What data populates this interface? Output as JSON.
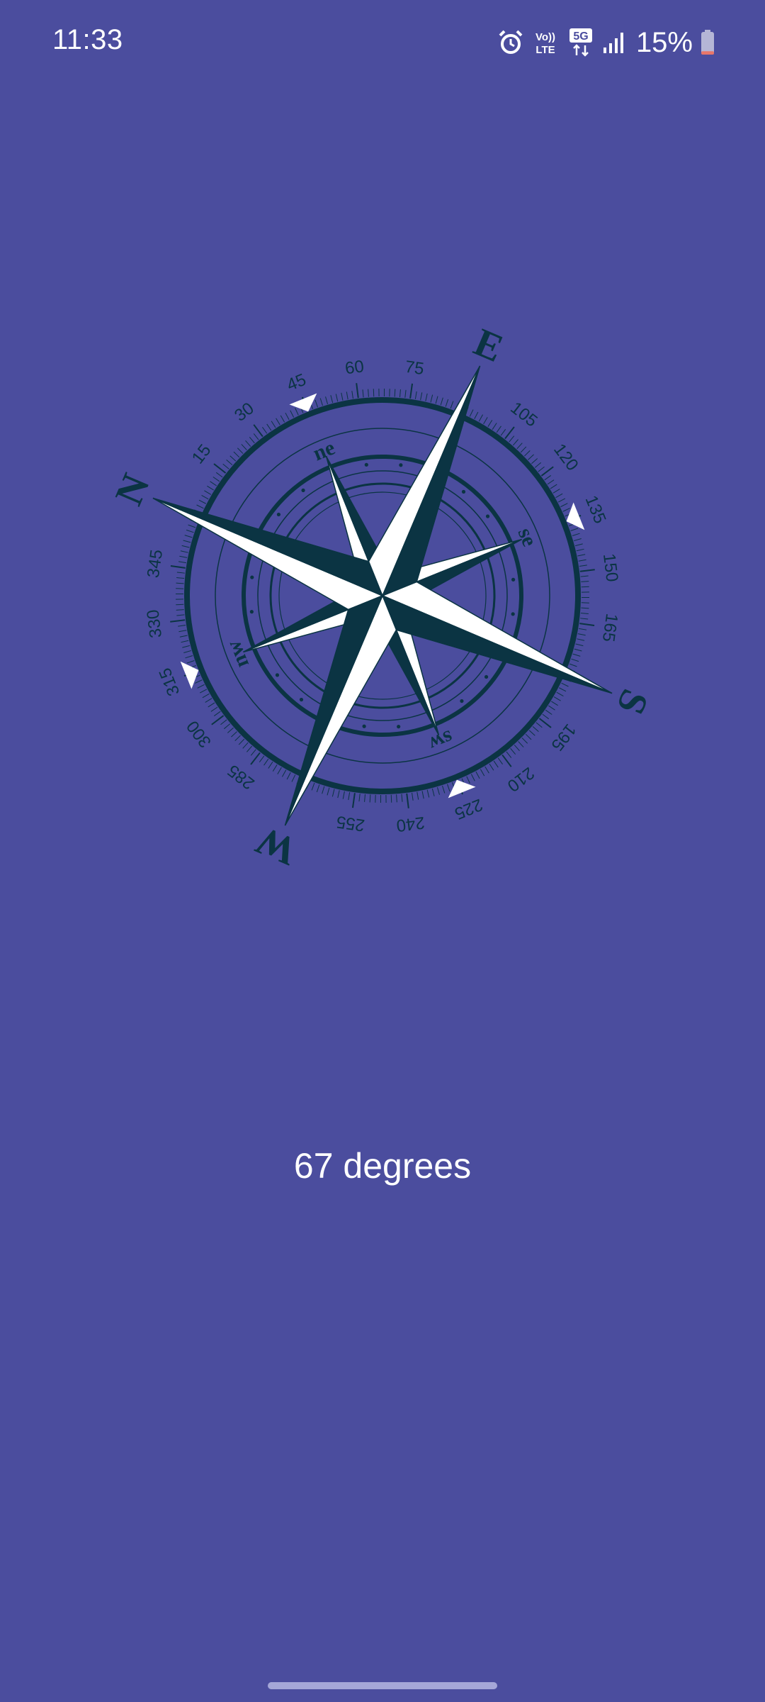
{
  "status_bar": {
    "time": "11:33",
    "alarm_icon": "alarm-icon",
    "volte_top": "Vo))",
    "volte_bottom": "LTE",
    "network_type": "5G",
    "signal_icon": "signal-icon",
    "battery_percent": "15%",
    "battery_level": 0.15
  },
  "compass": {
    "heading_degrees": 67,
    "cardinals": [
      "N",
      "E",
      "S",
      "W"
    ],
    "intercardinals": [
      "ne",
      "se",
      "sw",
      "nw"
    ],
    "degree_labels": [
      "15",
      "30",
      "45",
      "60",
      "75",
      "105",
      "120",
      "135",
      "150",
      "165",
      "195",
      "210",
      "225",
      "240",
      "255",
      "285",
      "300",
      "315",
      "330",
      "345"
    ],
    "colors": {
      "dark": "#0b3443",
      "light": "#ffffff",
      "background": "#4b4d9e"
    }
  },
  "main": {
    "heading_text": "67 degrees"
  }
}
